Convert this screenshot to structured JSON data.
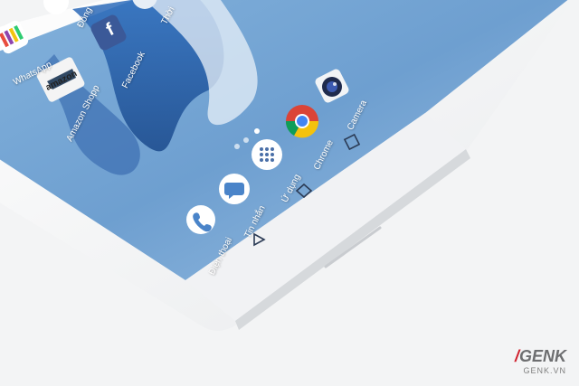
{
  "photo": {
    "apps": [
      {
        "id": "whatsapp",
        "label": "WhatsApp"
      },
      {
        "id": "facebook",
        "label": "Facebook"
      },
      {
        "id": "amazon",
        "label": "Amazon Shopp",
        "icon_text": "amazon"
      },
      {
        "id": "camera",
        "label": "Camera"
      },
      {
        "id": "chrome",
        "label": "Chrome"
      },
      {
        "id": "apps",
        "label": "Ứ dụng"
      },
      {
        "id": "messages",
        "label": "Tin nhắn"
      },
      {
        "id": "phone",
        "label": "Điện thoại"
      }
    ],
    "top_cut_labels": [
      "Đồng",
      "Thời"
    ],
    "nav_keys": [
      "back-key",
      "home-key",
      "recents-key"
    ],
    "page_dots": 3,
    "active_dot": 2
  },
  "watermark": {
    "logo_text": "GENK",
    "site": "GENK.VN"
  },
  "colors": {
    "screen": "#6d9fce",
    "body": "#f3f4f5",
    "brand_red": "#d01f2c"
  }
}
